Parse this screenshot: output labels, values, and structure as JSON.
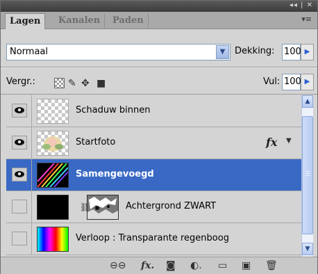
{
  "window": {
    "controls": "◂◂ | ✕"
  },
  "tabs": [
    {
      "label": "Lagen",
      "active": true
    },
    {
      "label": "Kanalen",
      "active": false
    },
    {
      "label": "Paden",
      "active": false
    }
  ],
  "panel_menu_icon": "panel-menu-icon",
  "blend_mode": {
    "value": "Normaal"
  },
  "opacity": {
    "label": "Dekking:",
    "value": "100%"
  },
  "lock": {
    "label": "Vergr.:"
  },
  "fill": {
    "label": "Vul:",
    "value": "100%"
  },
  "layers": [
    {
      "name": "Schaduw binnen",
      "visible": true,
      "selected": false,
      "thumb": "checker"
    },
    {
      "name": "Startfoto",
      "visible": true,
      "selected": false,
      "thumb": "photo",
      "fx": "fx"
    },
    {
      "name": "Samengevoegd",
      "visible": true,
      "selected": true,
      "thumb": "rainbow-streaks"
    },
    {
      "name": "Achtergrond ZWART",
      "visible": false,
      "selected": false,
      "thumb": "black",
      "mask": true
    },
    {
      "name": "Verloop : Transparante regenboog",
      "visible": false,
      "selected": false,
      "thumb": "gradient"
    }
  ],
  "colors": {
    "selection": "#3969c5",
    "panel": "#d4d4d4"
  }
}
